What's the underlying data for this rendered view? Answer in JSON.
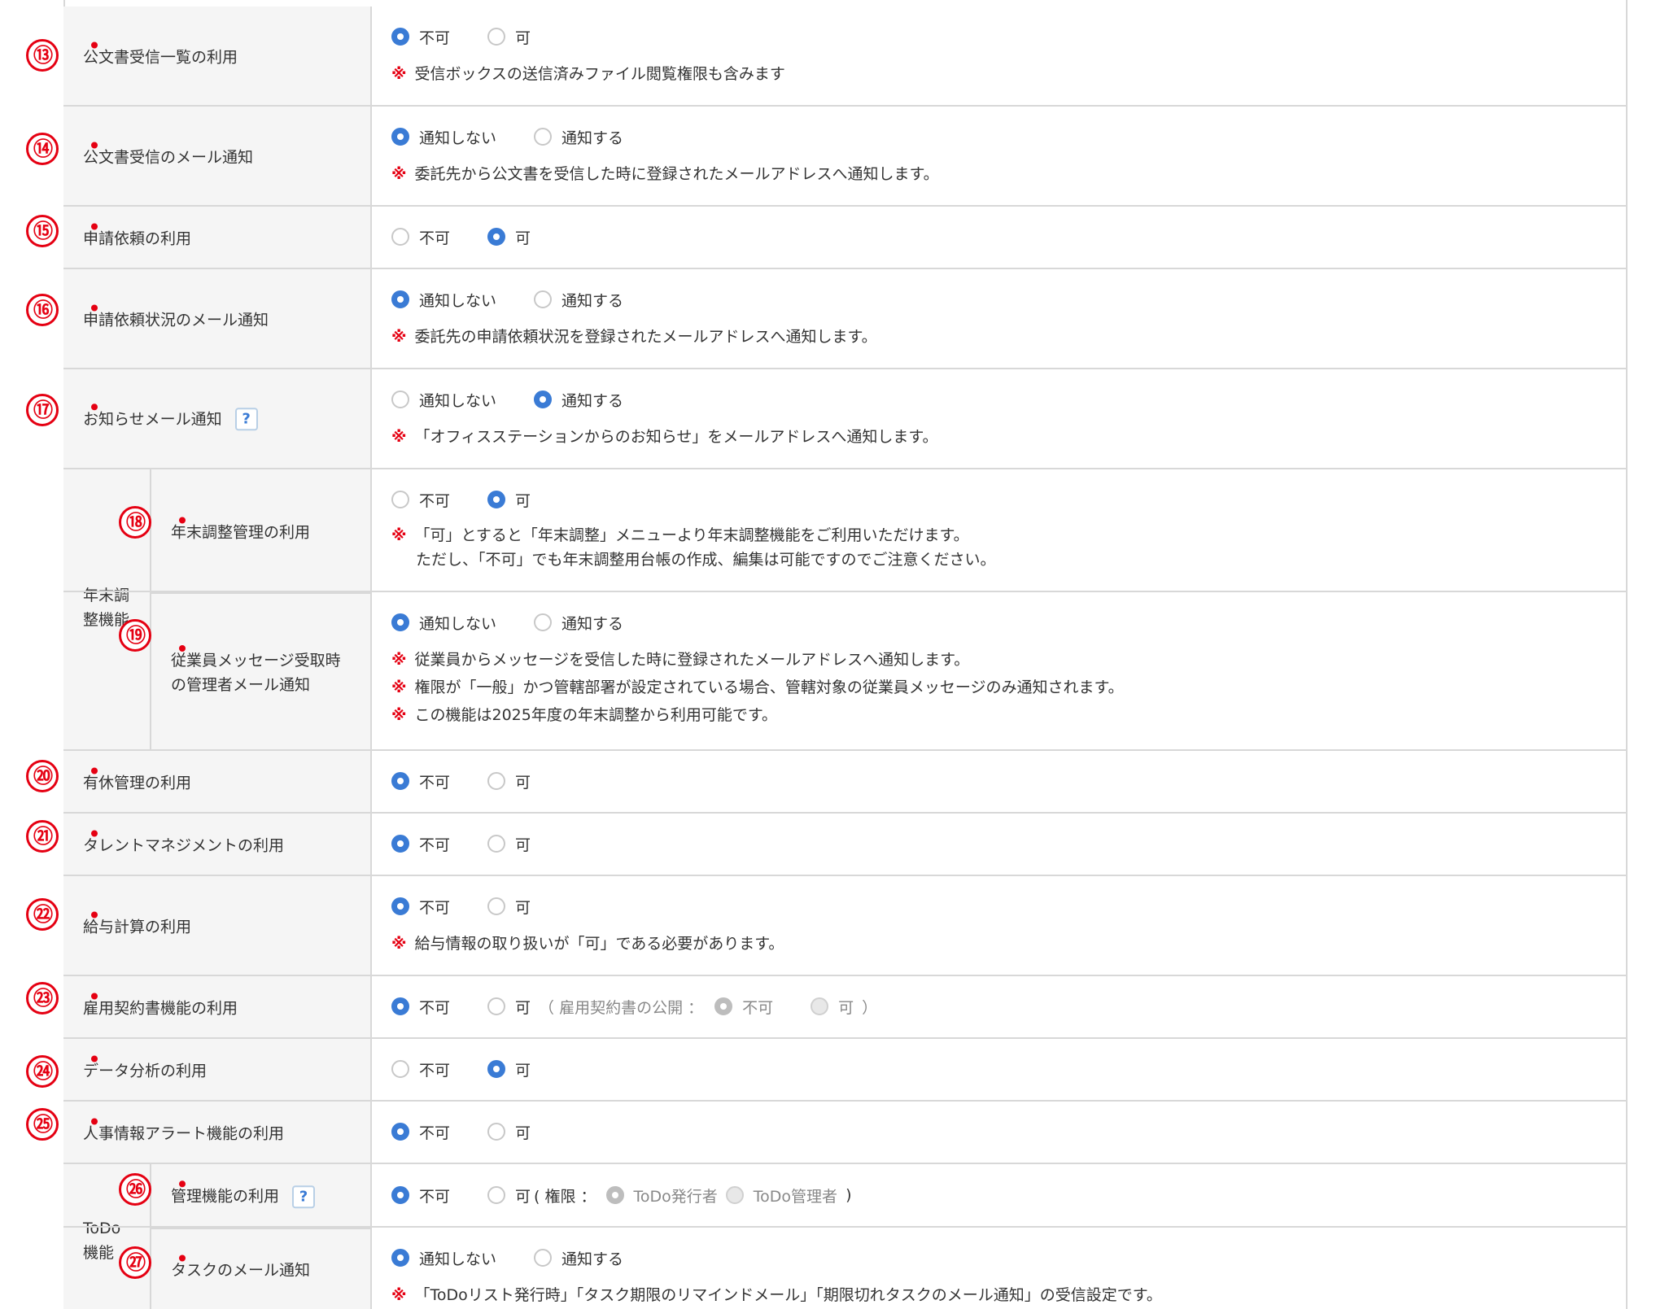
{
  "colors": {
    "accent": "#3a7bd5",
    "marker": "#e50012",
    "label_bg": "#f5f5f5",
    "border": "#d8d8d8"
  },
  "icons": {
    "help": "question-icon",
    "required": "required-dot",
    "radio": "radio-button"
  },
  "note_mark": "※",
  "help_glyph": "?",
  "rows": {
    "r13": {
      "num": "⑬",
      "label": "公文書受信一覧の利用",
      "opt1": "不可",
      "opt2": "可",
      "selected": "opt1",
      "notes": [
        "受信ボックスの送信済みファイル閲覧権限も含みます"
      ]
    },
    "r14": {
      "num": "⑭",
      "label": "公文書受信のメール通知",
      "opt1": "通知しない",
      "opt2": "通知する",
      "selected": "opt1",
      "notes": [
        "委託先から公文書を受信した時に登録されたメールアドレスへ通知します。"
      ]
    },
    "r15": {
      "num": "⑮",
      "label": "申請依頼の利用",
      "opt1": "不可",
      "opt2": "可",
      "selected": "opt2"
    },
    "r16": {
      "num": "⑯",
      "label": "申請依頼状況のメール通知",
      "opt1": "通知しない",
      "opt2": "通知する",
      "selected": "opt1",
      "notes": [
        "委託先の申請依頼状況を登録されたメールアドレスへ通知します。"
      ]
    },
    "r17": {
      "num": "⑰",
      "label": "お知らせメール通知",
      "opt1": "通知しない",
      "opt2": "通知する",
      "selected": "opt2",
      "notes": [
        "「オフィスステーションからのお知らせ」をメールアドレスへ通知します。"
      ]
    },
    "r18": {
      "num": "⑱",
      "label": "年末調整管理の利用",
      "opt1": "不可",
      "opt2": "可",
      "selected": "opt2",
      "notes": [
        "「可」とすると「年末調整」メニューより年末調整機能をご利用いただけます。",
        "ただし、「不可」でも年末調整用台帳の作成、編集は可能ですのでご注意ください。"
      ]
    },
    "r19": {
      "num": "⑲",
      "label": "従業員メッセージ受取時の管理者メール通知",
      "opt1": "通知しない",
      "opt2": "通知する",
      "selected": "opt1",
      "notes": [
        "従業員からメッセージを受信した時に登録されたメールアドレスへ通知します。",
        "権限が「一般」かつ管轄部署が設定されている場合、管轄対象の従業員メッセージのみ通知されます。",
        "この機能は2025年度の年末調整から利用可能です。"
      ]
    },
    "r20": {
      "num": "⑳",
      "label": "有休管理の利用",
      "opt1": "不可",
      "opt2": "可",
      "selected": "opt1"
    },
    "r21": {
      "num": "㉑",
      "label": "タレントマネジメントの利用",
      "opt1": "不可",
      "opt2": "可",
      "selected": "opt1"
    },
    "r22": {
      "num": "㉒",
      "label": "給与計算の利用",
      "opt1": "不可",
      "opt2": "可",
      "selected": "opt1",
      "notes": [
        "給与情報の取り扱いが「可」である必要があります。"
      ]
    },
    "r23": {
      "num": "㉓",
      "label": "雇用契約書機能の利用",
      "opt1": "不可",
      "opt2": "可",
      "selected": "opt1",
      "sub_open": "（ 雇用契約書の公開 ：",
      "sub_opt1": "不可",
      "sub_opt2": "可",
      "sub_close": "）"
    },
    "r24": {
      "num": "㉔",
      "label": "データ分析の利用",
      "opt1": "不可",
      "opt2": "可",
      "selected": "opt2"
    },
    "r25": {
      "num": "㉕",
      "label": "人事情報アラート機能の利用",
      "opt1": "不可",
      "opt2": "可",
      "selected": "opt1"
    },
    "r26": {
      "num": "㉖",
      "label": "管理機能の利用",
      "opt1": "不可",
      "opt2": "可",
      "selected": "opt1",
      "sub_open": "( 権限 ：",
      "sub_opt1": "ToDo発行者",
      "sub_opt2": "ToDo管理者",
      "sub_close": ")"
    },
    "r27": {
      "num": "㉗",
      "label": "タスクのメール通知",
      "opt1": "通知しない",
      "opt2": "通知する",
      "selected": "opt1",
      "notes": [
        "「ToDoリスト発行時」「タスク期限のリマインドメール」「期限切れタスクのメール通知」の受信設定です。"
      ]
    }
  },
  "groups": {
    "nencho": {
      "label_line1": "年末調",
      "label_line2": "整機能"
    },
    "todo": {
      "label_line1": "ToDo",
      "label_line2": "機能"
    }
  }
}
